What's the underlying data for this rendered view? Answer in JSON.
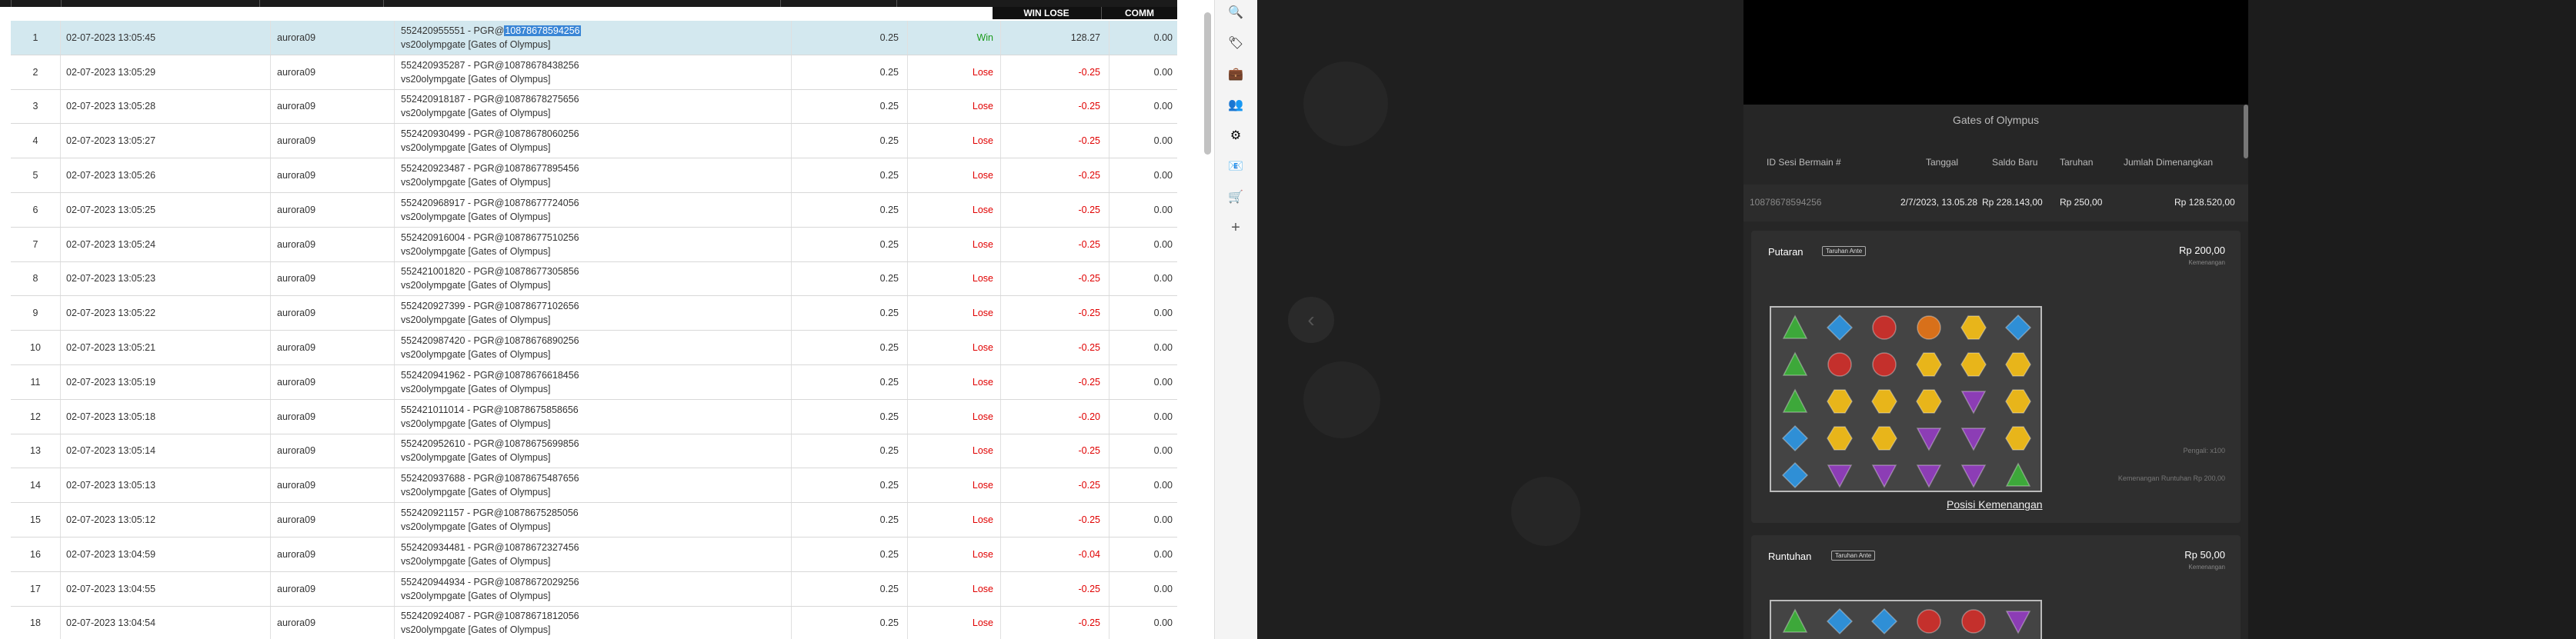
{
  "table": {
    "headers": {
      "win_lose": "WIN LOSE",
      "comm": "COMM"
    },
    "rows": [
      {
        "no": "1",
        "date": "02-07-2023 13:05:45",
        "user": "aurora09",
        "txid": "552420955551 - PGR@",
        "round": "10878678594256",
        "game": "vs20olympgate [Gates of Olympus]",
        "bet": "0.25",
        "result": "Win",
        "winlose": "128.27",
        "comm": "0.00",
        "selected": true
      },
      {
        "no": "2",
        "date": "02-07-2023 13:05:29",
        "user": "aurora09",
        "txid": "552420935287 - PGR@",
        "round": "10878678438256",
        "game": "vs20olympgate [Gates of Olympus]",
        "bet": "0.25",
        "result": "Lose",
        "winlose": "-0.25",
        "comm": "0.00"
      },
      {
        "no": "3",
        "date": "02-07-2023 13:05:28",
        "user": "aurora09",
        "txid": "552420918187 - PGR@",
        "round": "10878678275656",
        "game": "vs20olympgate [Gates of Olympus]",
        "bet": "0.25",
        "result": "Lose",
        "winlose": "-0.25",
        "comm": "0.00"
      },
      {
        "no": "4",
        "date": "02-07-2023 13:05:27",
        "user": "aurora09",
        "txid": "552420930499 - PGR@",
        "round": "10878678060256",
        "game": "vs20olympgate [Gates of Olympus]",
        "bet": "0.25",
        "result": "Lose",
        "winlose": "-0.25",
        "comm": "0.00"
      },
      {
        "no": "5",
        "date": "02-07-2023 13:05:26",
        "user": "aurora09",
        "txid": "552420923487 - PGR@",
        "round": "10878677895456",
        "game": "vs20olympgate [Gates of Olympus]",
        "bet": "0.25",
        "result": "Lose",
        "winlose": "-0.25",
        "comm": "0.00"
      },
      {
        "no": "6",
        "date": "02-07-2023 13:05:25",
        "user": "aurora09",
        "txid": "552420968917 - PGR@",
        "round": "10878677724056",
        "game": "vs20olympgate [Gates of Olympus]",
        "bet": "0.25",
        "result": "Lose",
        "winlose": "-0.25",
        "comm": "0.00"
      },
      {
        "no": "7",
        "date": "02-07-2023 13:05:24",
        "user": "aurora09",
        "txid": "552420916004 - PGR@",
        "round": "10878677510256",
        "game": "vs20olympgate [Gates of Olympus]",
        "bet": "0.25",
        "result": "Lose",
        "winlose": "-0.25",
        "comm": "0.00"
      },
      {
        "no": "8",
        "date": "02-07-2023 13:05:23",
        "user": "aurora09",
        "txid": "552421001820 - PGR@",
        "round": "10878677305856",
        "game": "vs20olympgate [Gates of Olympus]",
        "bet": "0.25",
        "result": "Lose",
        "winlose": "-0.25",
        "comm": "0.00"
      },
      {
        "no": "9",
        "date": "02-07-2023 13:05:22",
        "user": "aurora09",
        "txid": "552420927399 - PGR@",
        "round": "10878677102656",
        "game": "vs20olympgate [Gates of Olympus]",
        "bet": "0.25",
        "result": "Lose",
        "winlose": "-0.25",
        "comm": "0.00"
      },
      {
        "no": "10",
        "date": "02-07-2023 13:05:21",
        "user": "aurora09",
        "txid": "552420987420 - PGR@",
        "round": "10878676890256",
        "game": "vs20olympgate [Gates of Olympus]",
        "bet": "0.25",
        "result": "Lose",
        "winlose": "-0.25",
        "comm": "0.00"
      },
      {
        "no": "11",
        "date": "02-07-2023 13:05:19",
        "user": "aurora09",
        "txid": "552420941962 - PGR@",
        "round": "10878676618456",
        "game": "vs20olympgate [Gates of Olympus]",
        "bet": "0.25",
        "result": "Lose",
        "winlose": "-0.25",
        "comm": "0.00"
      },
      {
        "no": "12",
        "date": "02-07-2023 13:05:18",
        "user": "aurora09",
        "txid": "552421011014 - PGR@",
        "round": "10878675858656",
        "game": "vs20olympgate [Gates of Olympus]",
        "bet": "0.25",
        "result": "Lose",
        "winlose": "-0.20",
        "comm": "0.00"
      },
      {
        "no": "13",
        "date": "02-07-2023 13:05:14",
        "user": "aurora09",
        "txid": "552420952610 - PGR@",
        "round": "10878675699856",
        "game": "vs20olympgate [Gates of Olympus]",
        "bet": "0.25",
        "result": "Lose",
        "winlose": "-0.25",
        "comm": "0.00"
      },
      {
        "no": "14",
        "date": "02-07-2023 13:05:13",
        "user": "aurora09",
        "txid": "552420937688 - PGR@",
        "round": "10878675487656",
        "game": "vs20olympgate [Gates of Olympus]",
        "bet": "0.25",
        "result": "Lose",
        "winlose": "-0.25",
        "comm": "0.00"
      },
      {
        "no": "15",
        "date": "02-07-2023 13:05:12",
        "user": "aurora09",
        "txid": "552420921157 - PGR@",
        "round": "10878675285056",
        "game": "vs20olympgate [Gates of Olympus]",
        "bet": "0.25",
        "result": "Lose",
        "winlose": "-0.25",
        "comm": "0.00"
      },
      {
        "no": "16",
        "date": "02-07-2023 13:04:59",
        "user": "aurora09",
        "txid": "552420934481 - PGR@",
        "round": "10878672327456",
        "game": "vs20olympgate [Gates of Olympus]",
        "bet": "0.25",
        "result": "Lose",
        "winlose": "-0.04",
        "comm": "0.00"
      },
      {
        "no": "17",
        "date": "02-07-2023 13:04:55",
        "user": "aurora09",
        "txid": "552420944934 - PGR@",
        "round": "10878672029256",
        "game": "vs20olympgate [Gates of Olympus]",
        "bet": "0.25",
        "result": "Lose",
        "winlose": "-0.25",
        "comm": "0.00"
      },
      {
        "no": "18",
        "date": "02-07-2023 13:04:54",
        "user": "aurora09",
        "txid": "552420924087 - PGR@",
        "round": "10878671812056",
        "game": "vs20olympgate [Gates of Olympus]",
        "bet": "0.25",
        "result": "Lose",
        "winlose": "-0.25",
        "comm": "0.00"
      }
    ]
  },
  "sidebar": {
    "icons": [
      {
        "name": "search-icon",
        "glyph": "🔍"
      },
      {
        "name": "tag-icon",
        "glyph": "🏷"
      },
      {
        "name": "briefcase-icon",
        "glyph": "💼"
      },
      {
        "name": "people-icon",
        "glyph": "👥"
      },
      {
        "name": "gear-icon",
        "glyph": "⚙"
      },
      {
        "name": "outlook-icon",
        "glyph": "📧"
      },
      {
        "name": "cart-icon",
        "glyph": "🛒"
      },
      {
        "name": "add-icon",
        "glyph": "+"
      }
    ]
  },
  "game": {
    "title": "Gates of Olympus",
    "headers": {
      "id": "ID Sesi Bermain #",
      "date": "Tanggal",
      "saldo": "Saldo Baru",
      "bet": "Taruhan",
      "total": "Jumlah Dimenangkan"
    },
    "values": {
      "id": "10878678594256",
      "date": "2/7/2023, 13.05.28",
      "saldo": "Rp 228.143,00",
      "bet": "Rp 250,00",
      "total": "Rp 128.520,00"
    },
    "spin": {
      "title": "Putaran",
      "tag": "Taruhan Ante",
      "amount": "Rp 200,00",
      "amount_label": "Kemenangan",
      "note1": "Pengali: x100",
      "note2": "Kemenangan Runtuhan Rp 200,00",
      "link": "Posisi Kemenangan",
      "symbols": [
        [
          "green",
          "blue",
          "red",
          "crown",
          "gold",
          "blue"
        ],
        [
          "green",
          "red",
          "red",
          "gold",
          "gold",
          "gold"
        ],
        [
          "green",
          "gold",
          "gold",
          "gold",
          "purple",
          "gold"
        ],
        [
          "blue",
          "gold",
          "gold",
          "purple",
          "purple",
          "gold"
        ],
        [
          "blue",
          "purple",
          "purple",
          "purple",
          "purple",
          "green"
        ]
      ]
    },
    "tumble": {
      "title": "Runtuhan",
      "tag": "Taruhan Ante",
      "amount": "Rp 50,00",
      "amount_label": "Kemenangan",
      "symbols": [
        [
          "green",
          "blue",
          "blue",
          "red",
          "red",
          "purple"
        ]
      ]
    },
    "colors": {
      "green": "#3da83a",
      "blue": "#2f8fd6",
      "red": "#c4302c",
      "gold": "#e8b51a",
      "purple": "#8c3db5",
      "crown": "#d8701a",
      "lose": "#e00000",
      "win": "#1a9a1a",
      "selection": "#3a86d6"
    }
  }
}
